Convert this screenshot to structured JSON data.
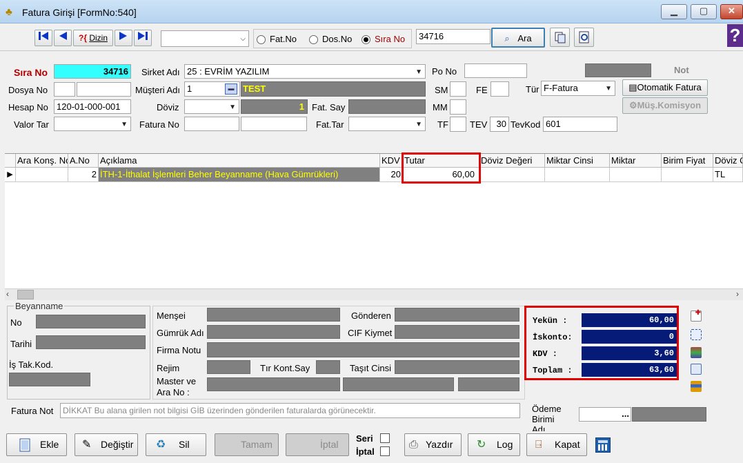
{
  "window": {
    "title": "Fatura Girişi [FormNo:540]"
  },
  "toolbar": {
    "first_label": "⏮",
    "prev_label": "◀",
    "next_label": "▶",
    "last_label": "⏭",
    "dizin_label": "Dizin",
    "search_mode_value": "",
    "radio_fat_no": "Fat.No",
    "radio_dos_no": "Dos.No",
    "radio_sira_no": "Sıra No",
    "selected_radio": "Sıra No",
    "search_value": "34716",
    "ara_label": "Ara"
  },
  "header": {
    "sira_no_label": "Sıra No",
    "sira_no_value": "34716",
    "sirket_adi_label": "Sirket Adı",
    "sirket_adi_value": "25 : EVRİM YAZILIM",
    "po_no_label": "Po No",
    "po_no_value": "",
    "not_label": "Not",
    "dosya_no_label": "Dosya No",
    "musteri_adi_label": "Müşteri Adı",
    "musteri_code": "1",
    "musteri_name": "TEST",
    "sm_label": "SM",
    "fe_label": "FE",
    "tur_label": "Tür",
    "tur_value": "F-Fatura",
    "otomatik_fatura_label": "Otomatik Fatura",
    "mus_komisyon_label": "Müş.Komisyon",
    "hesap_no_label": "Hesap No",
    "hesap_no_value": "120-01-000-001",
    "doviz_label": "Döviz",
    "doviz_kur": "1",
    "fat_say_label": "Fat. Say",
    "mm_label": "MM",
    "valor_tar_label": "Valor Tar",
    "fatura_no_label": "Fatura No",
    "fat_tar_label": "Fat.Tar",
    "tf_label": "TF",
    "tev_label": "TEV",
    "tev_value": "30",
    "tevkod_label": "TevKod",
    "tevkod_value": "601"
  },
  "grid": {
    "columns": [
      "Ara Konş. No",
      "A.No",
      "Açıklama",
      "KDV",
      "Tutar",
      "Döviz Değeri",
      "Miktar Cinsi",
      "Miktar",
      "Birim Fiyat",
      "Döviz Cinsi"
    ],
    "rows": [
      {
        "indicator": "▶",
        "ara_kons_no": "",
        "a_no": "2",
        "aciklama": "İTH-1-İthalat İşlemleri Beher Beyanname (Hava Gümrükleri)",
        "kdv": "20",
        "tutar": "60,00",
        "doviz_degeri": "",
        "miktar_cinsi": "",
        "miktar": "",
        "birim_fiyat": "",
        "doviz_cinsi": "TL"
      }
    ]
  },
  "beyanname": {
    "group_label": "Beyanname",
    "no_label": "No",
    "tarihi_label": "Tarihi",
    "is_takip_label": "İş Tak.Kod."
  },
  "details": {
    "mensei_label": "Menşei",
    "gonderen_label": "Gönderen",
    "gumruk_adi_label": "Gümrük Adı",
    "cif_kiymet_label": "CIF Kiymet",
    "firma_notu_label": "Firma Notu",
    "rejim_label": "Rejim",
    "tir_kont_say_label": "Tır Kont.Say",
    "tasit_cinsi_label": "Taşıt Cinsi",
    "master_label": "Master ve",
    "ara_no_label": "Ara No :"
  },
  "totals": {
    "yekun_label": "Yekün  :",
    "yekun_value": "60,00",
    "iskonto_label": "İskonto:",
    "iskonto_value": "0",
    "kdv_label": "KDV    :",
    "kdv_value": "3,60",
    "toplam_label": "Toplam :",
    "toplam_value": "63,60"
  },
  "footer": {
    "fatura_not_label": "Fatura Not",
    "fatura_not_placeholder": "DİKKAT Bu alana girilen not bilgisi GİB üzerinden gönderilen faturalarda görünecektir.",
    "odeme_label_1": "Ödeme",
    "odeme_label_2": "Birimi",
    "odeme_label_3": "Adı",
    "odeme_btn": "..."
  },
  "buttons": {
    "ekle": "Ekle",
    "degistir": "Değiştir",
    "sil": "Sil",
    "tamam": "Tamam",
    "iptal": "İptal",
    "seri_label": "Seri",
    "iptal_label": "İptal",
    "yazdir": "Yazdır",
    "log": "Log",
    "kapat": "Kapat"
  },
  "colors": {
    "highlight_cyan": "#33ffff",
    "total_bg": "#061a77",
    "red_frame": "#e10000",
    "row_bg": "#808080",
    "row_text": "#ffff00"
  }
}
